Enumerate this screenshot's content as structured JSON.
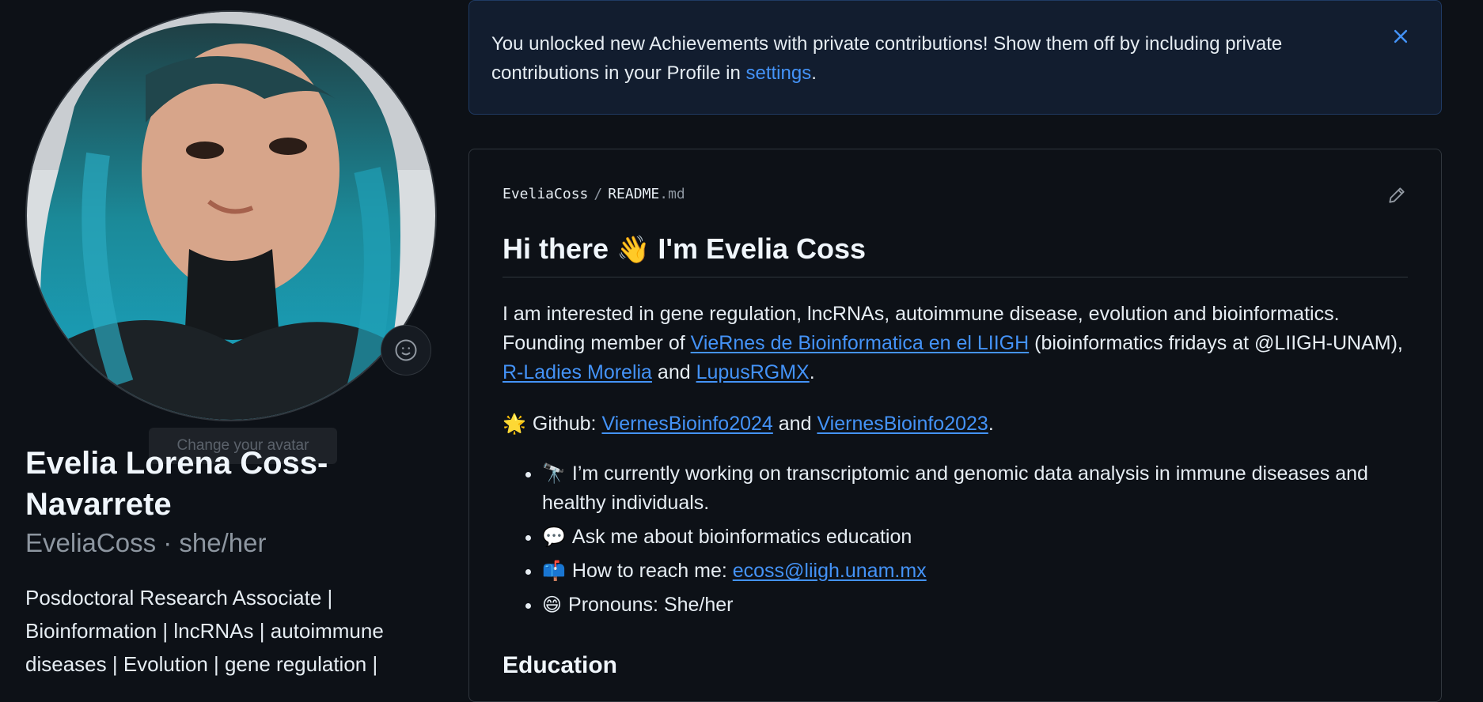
{
  "profile": {
    "avatar_alt": "avatar",
    "tooltip": "Change your avatar",
    "full_name": "Evelia Lorena Coss-Navarrete",
    "login": "EveliaCoss",
    "pronouns_sep": " · ",
    "pronouns": "she/her",
    "bio": "Posdoctoral Research Associate | Bioinformation | lncRNAs | autoimmune diseases | Evolution | gene regulation |"
  },
  "banner": {
    "text_before": "You unlocked new Achievements with private contributions! Show them off by including private contributions in your Profile in ",
    "link": "settings",
    "text_after": "."
  },
  "readme": {
    "owner": "EveliaCoss",
    "sep": "/",
    "file": "README",
    "ext": ".md",
    "heading_pre": "Hi there ",
    "heading_emoji": "👋",
    "heading_post": " I'm Evelia Coss",
    "intro": {
      "t1": "I am interested in gene regulation, lncRNAs, autoimmune disease, evolution and bioinformatics. Founding member of ",
      "l1": "VieRnes de Bioinformatica en el LIIGH",
      "t2": " (bioinformatics fridays at @LIIGH-UNAM), ",
      "l2": "R-Ladies Morelia",
      "t3": " and ",
      "l3": "LupusRGMX",
      "t4": "."
    },
    "github": {
      "emoji": "🌟",
      "t1": "Github: ",
      "l1": "ViernesBioinfo2024",
      "t2": " and ",
      "l2": "ViernesBioinfo2023",
      "t3": "."
    },
    "bullets": [
      {
        "emoji": "🔭",
        "text": "I’m currently working on transcriptomic and genomic data analysis in immune diseases and healthy individuals."
      },
      {
        "emoji": "💬",
        "text": "Ask me about bioinformatics education"
      },
      {
        "emoji": "📫",
        "text": "How to reach me: ",
        "link": "ecoss@liigh.unam.mx"
      },
      {
        "emoji": "😄",
        "text": "Pronouns: She/her"
      }
    ],
    "education_heading": "Education"
  },
  "icons": {
    "emoji_button": "smiley-icon",
    "close": "close-icon",
    "edit": "pencil-icon"
  }
}
